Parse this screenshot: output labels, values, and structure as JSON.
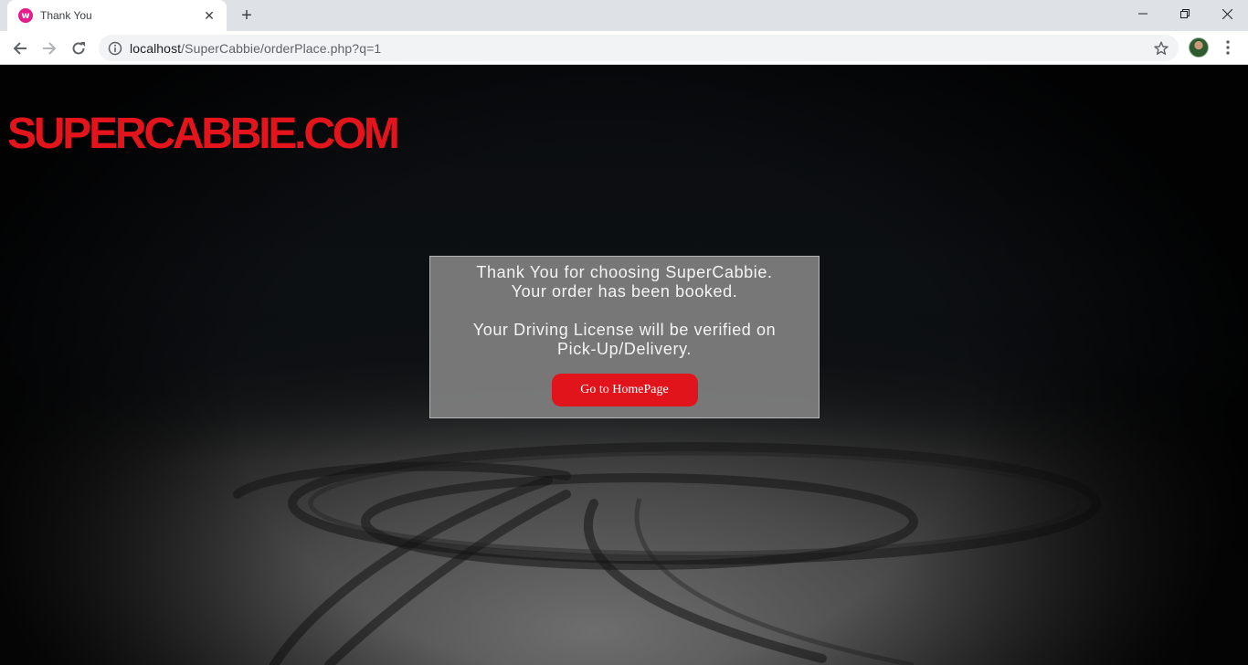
{
  "browser": {
    "tab": {
      "title": "Thank You",
      "favicon_letter": "w",
      "close_glyph": "✕"
    },
    "new_tab_glyph": "+",
    "window": {
      "minimize": "minimize-icon",
      "restore": "restore-icon",
      "close": "close-icon"
    },
    "address": {
      "host": "localhost",
      "path": "/SuperCabbie/orderPlace.php?q=1"
    },
    "icons": [
      "back-arrow-icon",
      "forward-arrow-icon",
      "reload-icon",
      "info-icon",
      "star-icon",
      "avatar",
      "kebab-menu-icon"
    ]
  },
  "page": {
    "logo": "SUPERCABBIE.COM",
    "message": {
      "line1": "Thank You for choosing SuperCabbie.",
      "line2": "Your order has been booked.",
      "line3": "Your Driving License will be verified on",
      "line4": "Pick-Up/Delivery."
    },
    "button_label": "Go to HomePage"
  },
  "colors": {
    "brand_red": "#e3141b",
    "card_bg": "#808080",
    "chrome_tabstrip": "#dee1e6"
  }
}
